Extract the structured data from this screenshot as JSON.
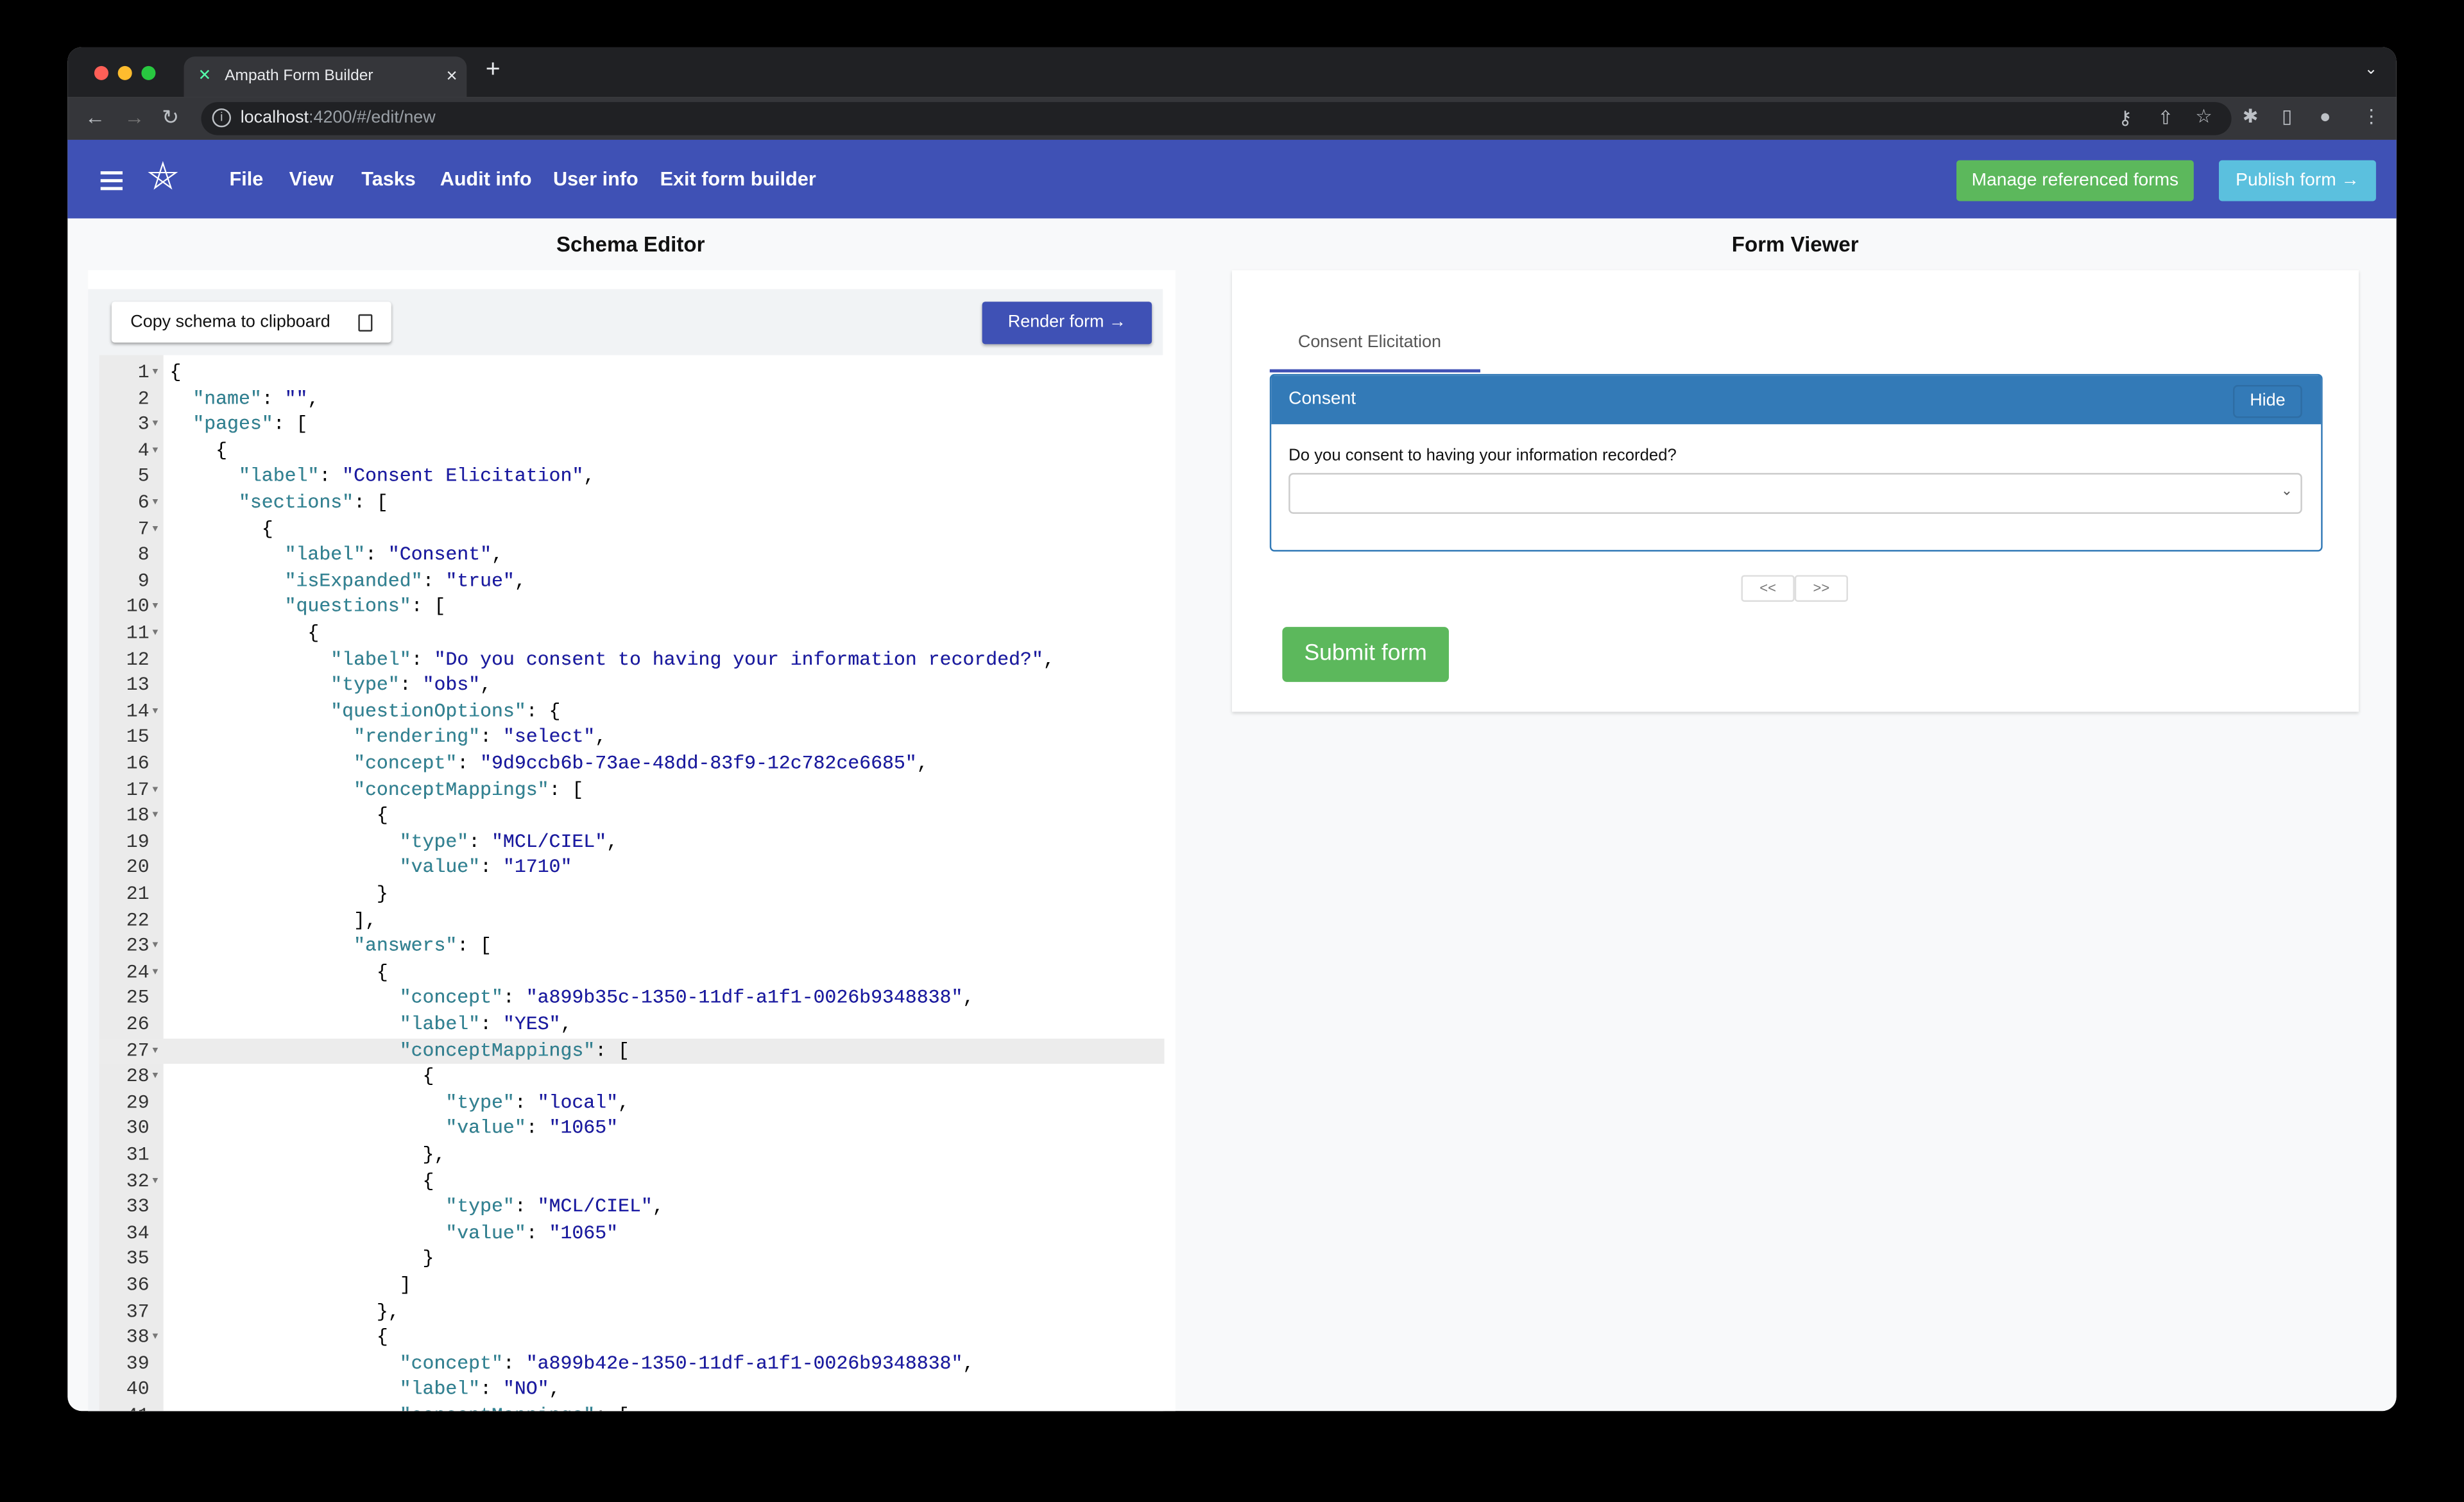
{
  "browser": {
    "tab_title": "Ampath Form Builder",
    "url_host": "localhost",
    "url_path": ":4200/#/edit/new",
    "icons": [
      "back-icon",
      "forward-icon",
      "reload-icon",
      "info-icon",
      "key-icon",
      "share-icon",
      "star-icon",
      "extensions-icon",
      "sidepanel-icon",
      "profile-icon",
      "more-icon"
    ]
  },
  "appbar": {
    "menu": [
      "File",
      "View",
      "Tasks",
      "Audit info",
      "User info",
      "Exit form builder"
    ],
    "manage_label": "Manage referenced forms",
    "publish_label": "Publish form →",
    "colors": {
      "primary": "#3f51b5",
      "success": "#5cb85c",
      "info": "#5bc0de"
    }
  },
  "schema_editor": {
    "title": "Schema Editor",
    "copy_label": "Copy schema to clipboard",
    "render_label": "Render form →",
    "active_line": 27,
    "folds": [
      1,
      3,
      4,
      6,
      7,
      10,
      11,
      14,
      17,
      18,
      23,
      24,
      27,
      28,
      32,
      38,
      41
    ],
    "lines": [
      "{",
      "  \"name\": \"\",",
      "  \"pages\": [",
      "    {",
      "      \"label\": \"Consent Elicitation\",",
      "      \"sections\": [",
      "        {",
      "          \"label\": \"Consent\",",
      "          \"isExpanded\": \"true\",",
      "          \"questions\": [",
      "            {",
      "              \"label\": \"Do you consent to having your information recorded?\",",
      "              \"type\": \"obs\",",
      "              \"questionOptions\": {",
      "                \"rendering\": \"select\",",
      "                \"concept\": \"9d9ccb6b-73ae-48dd-83f9-12c782ce6685\",",
      "                \"conceptMappings\": [",
      "                  {",
      "                    \"type\": \"MCL/CIEL\",",
      "                    \"value\": \"1710\"",
      "                  }",
      "                ],",
      "                \"answers\": [",
      "                  {",
      "                    \"concept\": \"a899b35c-1350-11df-a1f1-0026b9348838\",",
      "                    \"label\": \"YES\",",
      "                    \"conceptMappings\": [",
      "                      {",
      "                        \"type\": \"local\",",
      "                        \"value\": \"1065\"",
      "                      },",
      "                      {",
      "                        \"type\": \"MCL/CIEL\",",
      "                        \"value\": \"1065\"",
      "                      }",
      "                    ]",
      "                  },",
      "                  {",
      "                    \"concept\": \"a899b42e-1350-11df-a1f1-0026b9348838\",",
      "                    \"label\": \"NO\",",
      "                    \"conceptMappings\": ["
    ]
  },
  "form_viewer": {
    "title": "Form Viewer",
    "page_tab": "Consent Elicitation",
    "section_label": "Consent",
    "hide_label": "Hide",
    "question": "Do you consent to having your information recorded?",
    "select_value": "",
    "prev_label": "<<",
    "next_label": ">>",
    "submit_label": "Submit form"
  }
}
